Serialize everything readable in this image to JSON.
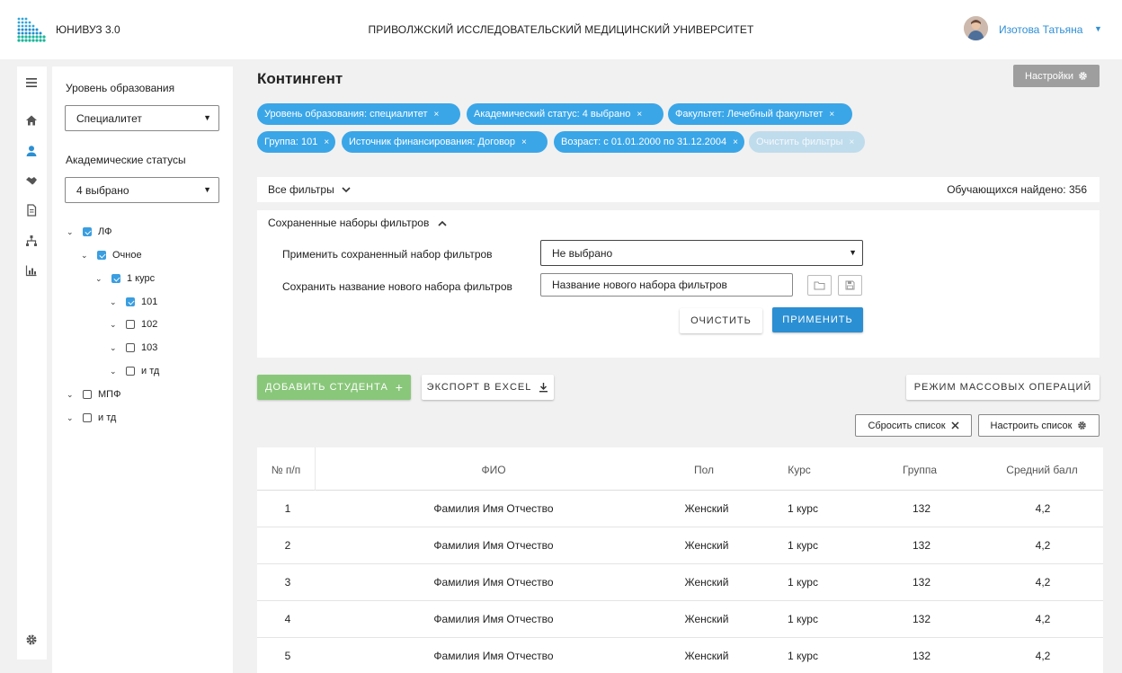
{
  "header": {
    "app_name": "ЮНИВУЗ 3.0",
    "university": "ПРИВОЛЖСКИЙ ИССЛЕДОВАТЕЛЬСКИЙ МЕДИЦИНСКИЙ УНИВЕРСИТЕТ",
    "user_name": "Изотова Татьяна",
    "user_caret": "▼"
  },
  "sidebar": {
    "level_label": "Уровень образования",
    "level_value": "Специалитет",
    "status_label": "Академические статусы",
    "status_value": "4 выбрано",
    "caret": "▼",
    "tree": [
      {
        "label": "ЛФ",
        "checked": true
      },
      {
        "label": "Очное",
        "checked": true
      },
      {
        "label": "1 курс",
        "checked": true
      },
      {
        "label": "101",
        "checked": true
      },
      {
        "label": "102",
        "checked": false
      },
      {
        "label": "103",
        "checked": false
      },
      {
        "label": "и тд",
        "checked": false
      },
      {
        "label": "МПФ",
        "checked": false
      },
      {
        "label": "и тд",
        "checked": false
      }
    ]
  },
  "main": {
    "title": "Контингент",
    "settings_label": "Настройки",
    "chips": [
      {
        "label": "Уровень образования: специалитет"
      },
      {
        "label": "Академический статус: 4 выбрано"
      },
      {
        "label": "Факультет: Лечебный факультет"
      },
      {
        "label": "Группа: 101"
      },
      {
        "label": "Источник финансирования: Договор"
      },
      {
        "label": "Возраст: с 01.01.2000 по 31.12.2004"
      },
      {
        "label": "Очистить фильтры"
      }
    ],
    "chip_close": "×",
    "all_filters": "Все фильтры",
    "found_text": "Обучающихся найдено: 356",
    "saved": {
      "title": "Сохраненные наборы фильтров",
      "apply_label": "Применить сохраненный набор фильтров",
      "apply_value": "Не выбрано",
      "save_label": "Сохранить название нового набора фильтров",
      "save_value": "Название нового набора фильтров",
      "clear_btn": "Очистить",
      "apply_btn": "Применить"
    },
    "add_student": "Добавить студента",
    "add_plus": "+",
    "export_excel": "Экспорт в Excel",
    "mass_ops": "Режим массовых операций",
    "reset_list": "Сбросить список",
    "configure_list": "Настроить список"
  },
  "table": {
    "headers": [
      "№ п/п",
      "ФИО",
      "Пол",
      "Курс",
      "Группа",
      "Средний балл"
    ],
    "rows": [
      [
        "1",
        "Фамилия Имя Отчество",
        "Женский",
        "1 курс",
        "132",
        "4,2"
      ],
      [
        "2",
        "Фамилия Имя Отчество",
        "Женский",
        "1 курс",
        "132",
        "4,2"
      ],
      [
        "3",
        "Фамилия Имя Отчество",
        "Женский",
        "1 курс",
        "132",
        "4,2"
      ],
      [
        "4",
        "Фамилия Имя Отчество",
        "Женский",
        "1 курс",
        "132",
        "4,2"
      ],
      [
        "5",
        "Фамилия Имя Отчество",
        "Женский",
        "1 курс",
        "132",
        "4,2"
      ]
    ]
  },
  "colors": {
    "accent": "#2b8fd3",
    "chip": "#3aa6e8",
    "green": "#89c77a"
  }
}
